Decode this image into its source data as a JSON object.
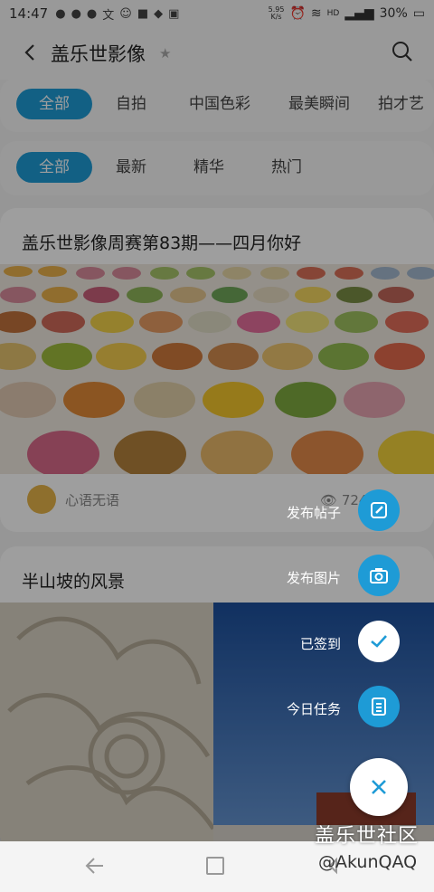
{
  "status_bar": {
    "time": "14:47",
    "speed_value": "5.95",
    "speed_unit": "K/s",
    "network": "HD",
    "battery": "30%"
  },
  "header": {
    "title": "盖乐世影像"
  },
  "category_tabs": [
    {
      "label": "全部",
      "active": true
    },
    {
      "label": "自拍",
      "active": false
    },
    {
      "label": "中国色彩",
      "active": false
    },
    {
      "label": "最美瞬间",
      "active": false
    },
    {
      "label": "拍才艺",
      "active": false
    }
  ],
  "sort_tabs": [
    {
      "label": "全部",
      "active": true
    },
    {
      "label": "最新",
      "active": false
    },
    {
      "label": "精华",
      "active": false
    },
    {
      "label": "热门",
      "active": false
    }
  ],
  "posts": [
    {
      "title": "盖乐世影像周赛第83期——四月你好",
      "author": "心语无语",
      "views": "72457"
    },
    {
      "title": "半山坡的风景"
    }
  ],
  "fab_menu": {
    "items": [
      {
        "label": "发布帖子",
        "icon": "edit-icon"
      },
      {
        "label": "发布图片",
        "icon": "camera-icon"
      },
      {
        "label": "已签到",
        "icon": "check-icon"
      },
      {
        "label": "今日任务",
        "icon": "task-list-icon"
      }
    ],
    "close_icon": "close-icon"
  },
  "watermark": {
    "brand": "盖乐世社区",
    "user": "@AkunQAQ"
  },
  "colors": {
    "accent": "#1e9bd6",
    "overlay": "rgba(0,0,0,0.38)"
  }
}
